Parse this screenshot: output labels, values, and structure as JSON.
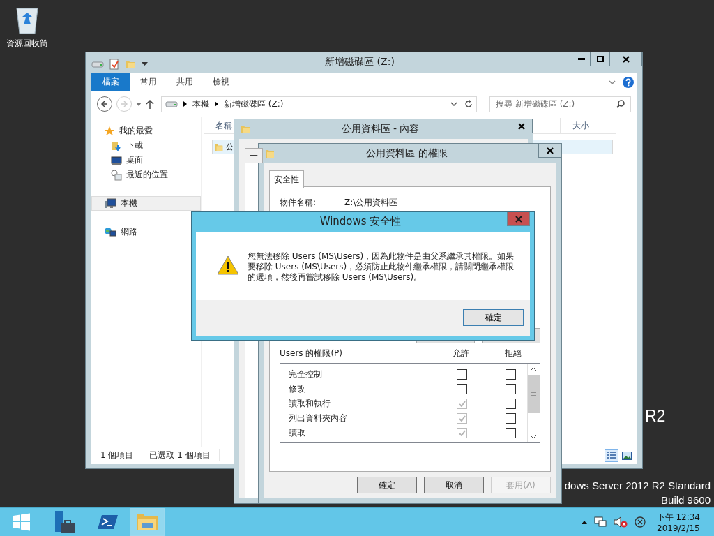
{
  "desktop": {
    "icons": [
      {
        "label": "資源回收筒"
      }
    ],
    "edition_text": [
      "R2",
      "dows Server 2012 R2 Standard",
      "Build 9600"
    ]
  },
  "explorer": {
    "title": "新增磁碟區 (Z:)",
    "ribbon_tabs": [
      {
        "label": "檔案",
        "selected": true
      },
      {
        "label": "常用",
        "selected": false
      },
      {
        "label": "共用",
        "selected": false
      },
      {
        "label": "檢視",
        "selected": false
      }
    ],
    "address": {
      "crumbs": [
        "本機",
        "新增磁碟區 (Z:)"
      ]
    },
    "search": {
      "placeholder": "搜尋 新增磁碟區 (Z:)"
    },
    "nav": [
      {
        "label": "我的最愛",
        "kind": "favorites",
        "selected": false,
        "children": [
          {
            "label": "下載",
            "kind": "downloads",
            "selected": false
          },
          {
            "label": "桌面",
            "kind": "desktop",
            "selected": false
          },
          {
            "label": "最近的位置",
            "kind": "recent",
            "selected": false
          }
        ]
      },
      {
        "label": "本機",
        "kind": "computer",
        "selected": true
      },
      {
        "label": "網路",
        "kind": "network",
        "selected": false
      }
    ],
    "columns": [
      "名稱",
      "大小"
    ],
    "rows": [
      {
        "name": "公",
        "selected": true
      }
    ],
    "status": [
      "1 個項目",
      "已選取 1 個項目"
    ]
  },
  "properties": {
    "title": "公用資料區 - 內容",
    "tabs": [
      {
        "label": "一",
        "selected": false
      }
    ]
  },
  "permissions": {
    "title": "公用資料區 的權限",
    "tabs": [
      {
        "label": "安全性",
        "selected": true
      }
    ],
    "object_label": "物件名稱:",
    "object_value": "Z:\\公用資料區",
    "permissions_label": "Users 的權限(P)",
    "allow_header": "允許",
    "deny_header": "拒絕",
    "rows": [
      {
        "name": "完全控制",
        "allow": {
          "checked": false,
          "disabled": false
        },
        "deny": {
          "checked": false
        }
      },
      {
        "name": "修改",
        "allow": {
          "checked": false,
          "disabled": false
        },
        "deny": {
          "checked": false
        }
      },
      {
        "name": "讀取和執行",
        "allow": {
          "checked": true,
          "disabled": true
        },
        "deny": {
          "checked": false
        }
      },
      {
        "name": "列出資料夾內容",
        "allow": {
          "checked": true,
          "disabled": true
        },
        "deny": {
          "checked": false
        }
      },
      {
        "name": "讀取",
        "allow": {
          "checked": true,
          "disabled": true
        },
        "deny": {
          "checked": false
        }
      }
    ],
    "buttons": [
      {
        "label": "確定",
        "disabled": false
      },
      {
        "label": "取消",
        "disabled": false
      },
      {
        "label": "套用(A)",
        "disabled": true
      }
    ]
  },
  "alert": {
    "title": "Windows 安全性",
    "message": "您無法移除 Users (MS\\Users)，因為此物件是由父系繼承其權限。如果要移除 Users (MS\\Users)，必須防止此物件繼承權限，請關閉繼承權限的選項，然後再嘗試移除 Users (MS\\Users)。",
    "button": "確定"
  },
  "taskbar": {
    "apps": [
      {
        "kind": "start",
        "selected": false
      },
      {
        "kind": "server-manager",
        "selected": false
      },
      {
        "kind": "powershell",
        "selected": false
      },
      {
        "kind": "explorer",
        "selected": true
      }
    ],
    "time": "下午 12:34",
    "date": "2019/2/15"
  }
}
